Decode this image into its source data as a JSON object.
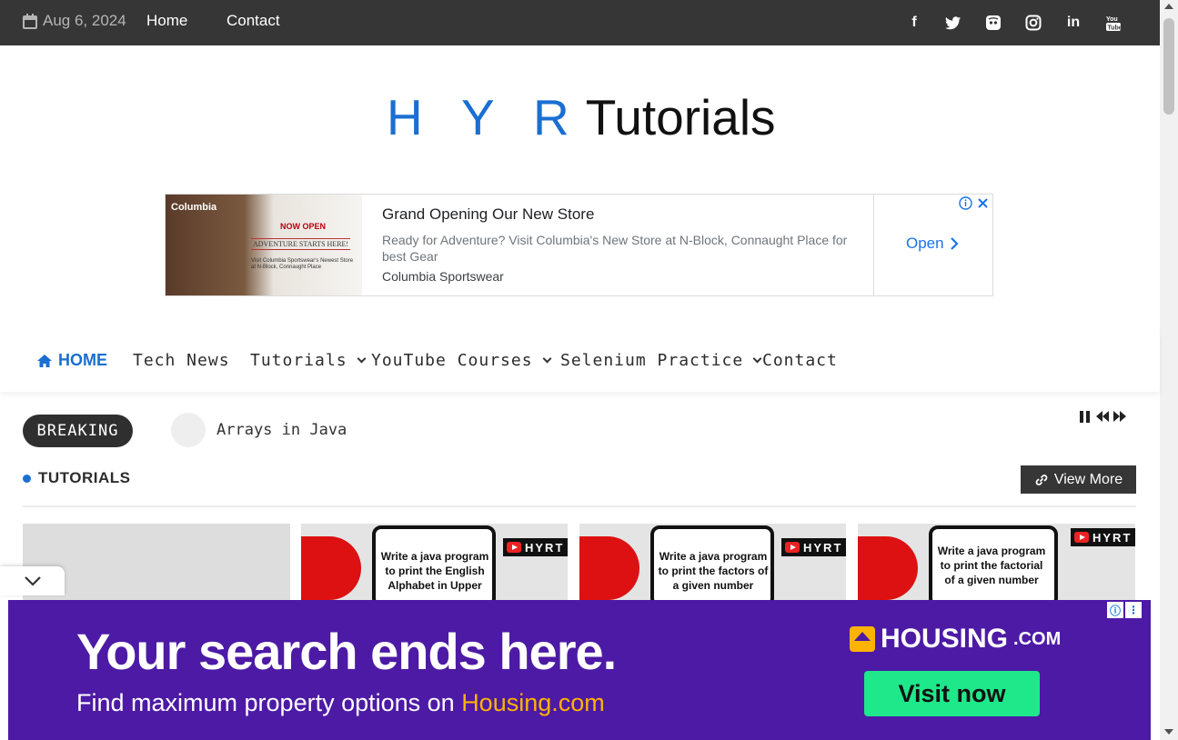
{
  "topbar": {
    "date": "Aug 6, 2024",
    "links": [
      "Home",
      "Contact"
    ],
    "social": [
      "facebook-icon",
      "twitter-icon",
      "discord-icon",
      "instagram-icon",
      "linkedin-icon",
      "youtube-icon"
    ]
  },
  "logo": {
    "part1": "H Y R",
    "part2": "Tutorials"
  },
  "top_ad": {
    "title": "Grand Opening Our New Store",
    "description": "Ready for Adventure? Visit Columbia's New Store at N-Block, Connaught Place for best Gear",
    "advertiser": "Columbia Sportswear",
    "cta": "Open",
    "image": {
      "brand": "Columbia",
      "now_open": "NOW OPEN",
      "tagline": "ADVENTURE STARTS HERE!",
      "small": "Visit Columbia Sportswear's Newest Store at N-Block, Connaught Place"
    }
  },
  "nav": {
    "home": "HOME",
    "items": [
      "Tech News",
      "Tutorials",
      "YouTube Courses",
      "Selenium Practice",
      "Contact"
    ]
  },
  "breaking": {
    "label": "BREAKING",
    "headline": "Arrays in Java"
  },
  "section": {
    "title": "TUTORIALS",
    "view_more": "View More"
  },
  "cards": [
    {
      "text": ""
    },
    {
      "text": "Write a java program to print the English Alphabet in Upper",
      "badge": "HYRT"
    },
    {
      "text": "Write a java program to print the factors of a given number",
      "badge": "HYRT"
    },
    {
      "text": "Write a java program to print the factorial of a given number",
      "badge": "HYRT"
    }
  ],
  "bottom_ad": {
    "headline": "Your search ends here.",
    "sub_prefix": "Find maximum property options on ",
    "sub_highlight": "Housing.com",
    "brand": "HOUSING",
    "brand_suffix": ".COM",
    "cta": "Visit now"
  },
  "colors": {
    "accent": "#1a6fd1",
    "topbar": "#363636",
    "ad_purple": "#4d1aa5",
    "cta_green": "#1ee88a"
  }
}
